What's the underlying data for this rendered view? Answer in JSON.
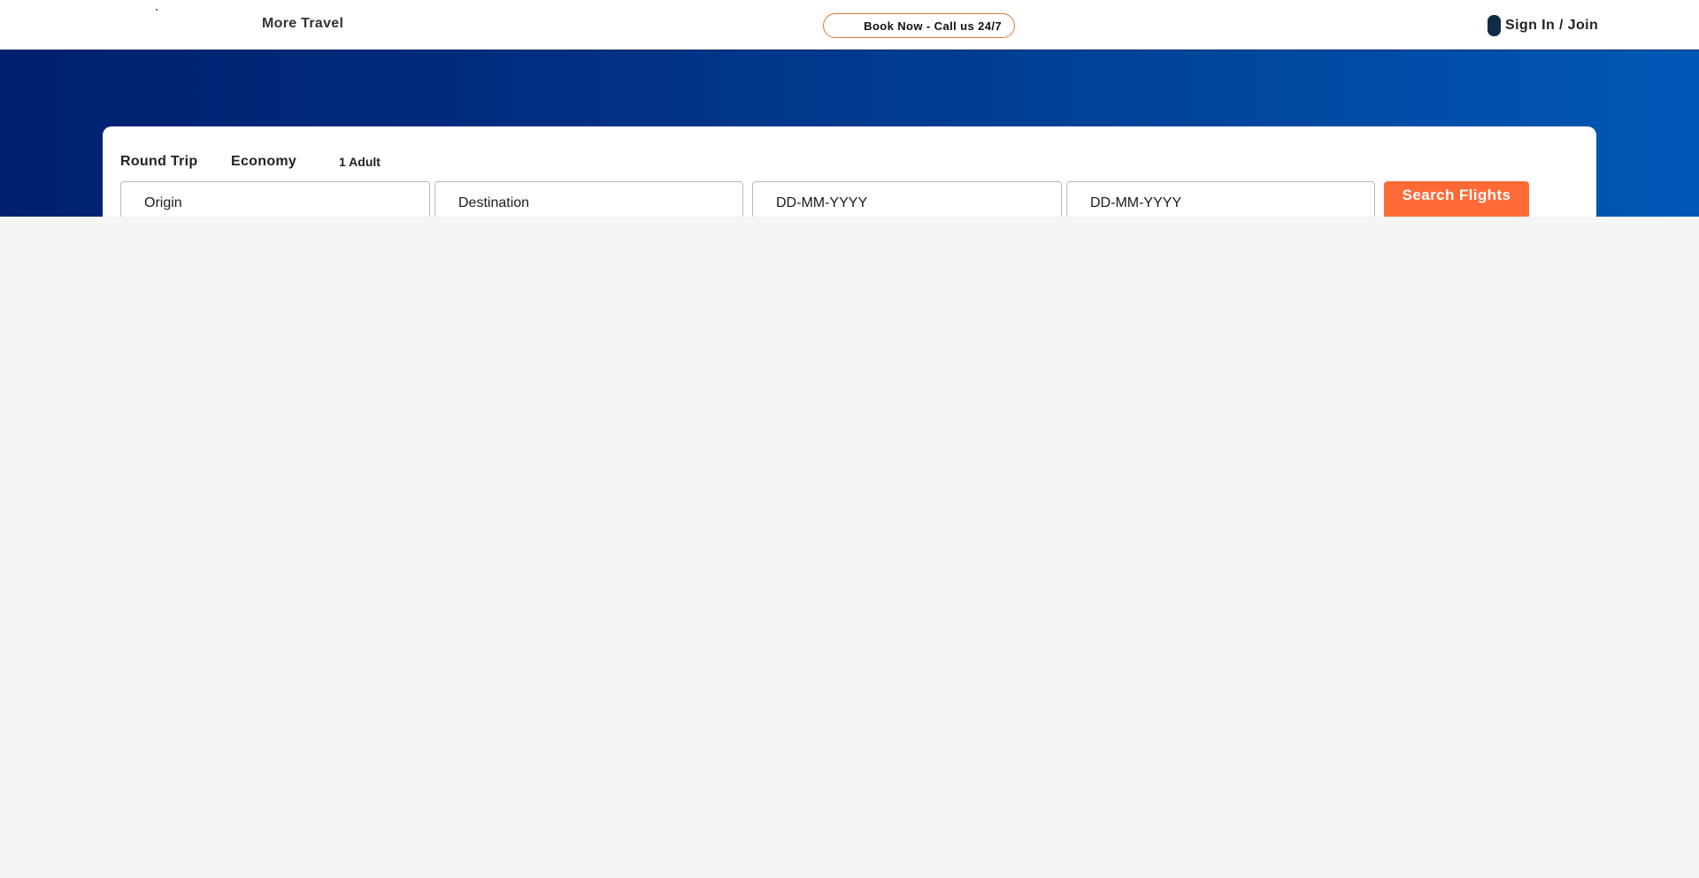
{
  "header": {
    "more_travel": "More Travel",
    "book_now": "Book Now - Call us 24/7",
    "sign_in": "Sign In / Join"
  },
  "search": {
    "trip_type": "Round Trip",
    "cabin_class": "Economy",
    "passengers": "1 Adult",
    "origin_placeholder": "Origin",
    "destination_placeholder": "Destination",
    "depart_placeholder": "DD-MM-YYYY",
    "return_placeholder": "DD-MM-YYYY",
    "search_button": "Search Flights"
  },
  "colors": {
    "hero_start": "#00206f",
    "hero_end": "#0058b6",
    "accent_orange": "#ff6a36",
    "pill_border": "#e0763a",
    "user_icon": "#0f2b46",
    "page_background": "#f5f5f5"
  },
  "icons": {
    "user": "user-icon",
    "logo": "logo-mark"
  }
}
